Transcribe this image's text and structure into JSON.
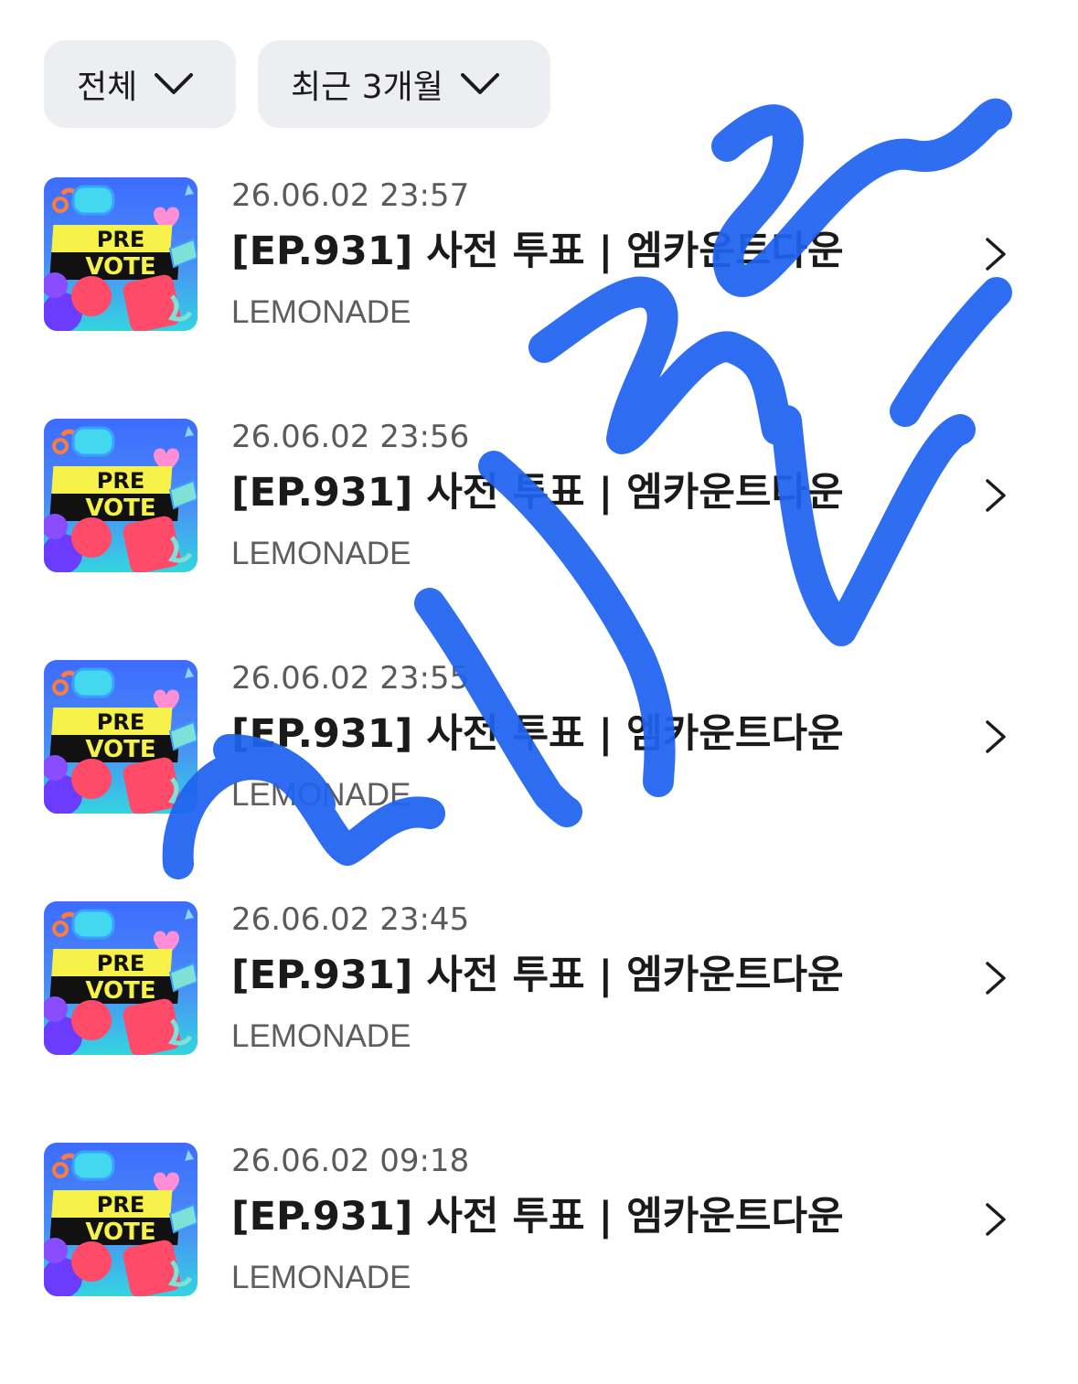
{
  "filters": {
    "category": {
      "label": "전체",
      "icon": "chevron-down-icon"
    },
    "period": {
      "label": "최근 3개월",
      "icon": "chevron-down-icon"
    }
  },
  "thumbnail": {
    "line1": "PRE",
    "line2": "VOTE",
    "colors": {
      "background_top": "#3d6bff",
      "background_bottom": "#34d4e0",
      "banner_yellow": "#f7f24a",
      "banner_black": "#111111",
      "heart_pink": "#ff8ed6",
      "ball_purple": "#6b3cff",
      "ball_red": "#ff4a6a"
    }
  },
  "items": [
    {
      "date": "26.06.02 23:57",
      "title": "[EP.931] 사전 투표 | 엠카운트다운",
      "brand": "LEMONADE"
    },
    {
      "date": "26.06.02 23:56",
      "title": "[EP.931] 사전 투표 | 엠카운트다운",
      "brand": "LEMONADE"
    },
    {
      "date": "26.06.02 23:55",
      "title": "[EP.931] 사전 투표 | 엠카운트다운",
      "brand": "LEMONADE"
    },
    {
      "date": "26.06.02 23:45",
      "title": "[EP.931] 사전 투표 | 엠카운트다운",
      "brand": "LEMONADE"
    },
    {
      "date": "26.06.02 09:18",
      "title": "[EP.931] 사전 투표 | 엠카운트다운",
      "brand": "LEMONADE"
    }
  ],
  "colors": {
    "chip_background": "#eceef1",
    "date_text": "#5a5a5a",
    "title_text": "#1a1a1a",
    "brand_text": "#5e5e5e",
    "scribble_blue": "#1f63f0"
  }
}
